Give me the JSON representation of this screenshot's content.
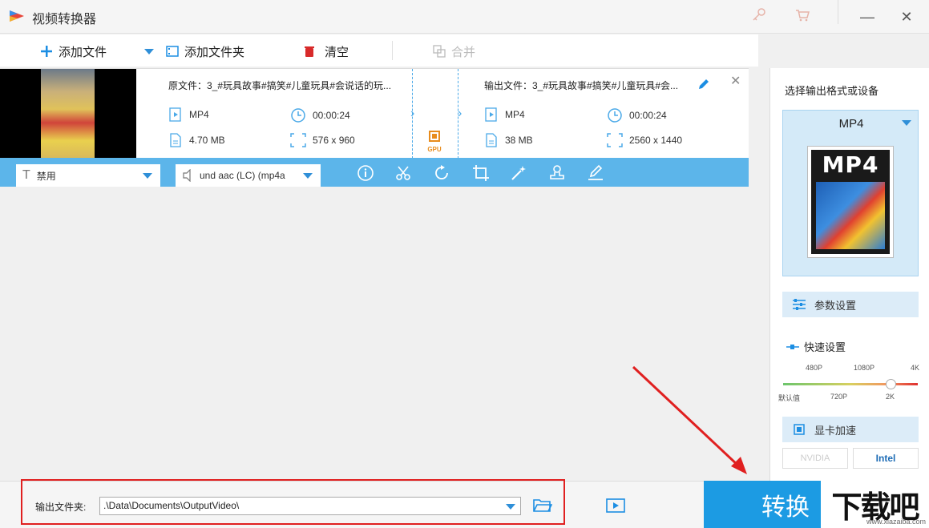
{
  "app": {
    "title": "视频转换器"
  },
  "toolbar": {
    "add_file": "添加文件",
    "add_folder": "添加文件夹",
    "clear": "清空",
    "merge": "合并"
  },
  "file": {
    "source_name": "原文件：3_#玩具故事#搞笑#儿童玩具#会说话的玩...",
    "output_name": "输出文件：3_#玩具故事#搞笑#儿童玩具#会...",
    "source": {
      "format": "MP4",
      "duration": "00:00:24",
      "size": "4.70 MB",
      "resolution": "576 x 960"
    },
    "output": {
      "format": "MP4",
      "duration": "00:00:24",
      "size": "38 MB",
      "resolution": "2560 x 1440"
    },
    "gpu_label": "GPU"
  },
  "edit_bar": {
    "subtitle_value": "禁用",
    "audio_value": "und aac (LC) (mp4a"
  },
  "right_panel": {
    "title": "选择输出格式或设备",
    "format": "MP4",
    "format_thumb_text": "MP4",
    "param_settings": "参数设置",
    "quick_settings": "快速设置",
    "quality_top": [
      "480P",
      "1080P",
      "4K"
    ],
    "quality_bottom": [
      "默认值",
      "720P",
      "2K"
    ],
    "quality_selected": "2K",
    "gpu_accel": "显卡加速",
    "vendors": [
      "NVIDIA",
      "Intel"
    ]
  },
  "bottom": {
    "output_label": "输出文件夹:",
    "output_path": ".\\Data\\Documents\\OutputVideo\\",
    "convert": "转换"
  },
  "watermark": {
    "text": "下载吧",
    "sub": "www.xiazaiba.com"
  },
  "colors": {
    "accent": "#1c9be3",
    "bar": "#5cb5ea",
    "annotation": "#e02020"
  }
}
